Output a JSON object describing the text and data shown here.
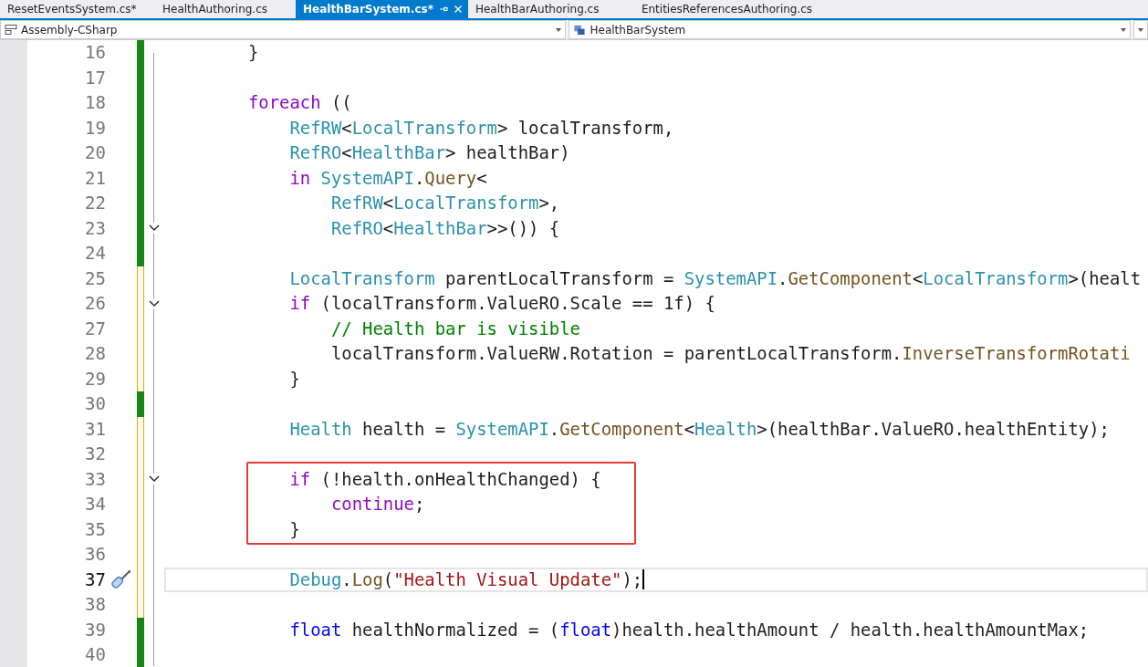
{
  "tabs": [
    {
      "label": "ResetEventsSystem.cs*",
      "selected": false
    },
    {
      "label": "HealthAuthoring.cs",
      "selected": false
    },
    {
      "label": "HealthBarSystem.cs*",
      "selected": true
    },
    {
      "label": "HealthBarAuthoring.cs",
      "selected": false
    },
    {
      "label": "EntitiesReferencesAuthoring.cs",
      "selected": false
    }
  ],
  "navigation_bar": {
    "project": "Assembly-CSharp",
    "type": "HealthBarSystem"
  },
  "editor": {
    "lines": [
      {
        "number": "16",
        "saved": true,
        "fold": false,
        "boxed": false,
        "current": false,
        "tokens": [
          {
            "kind": "plain",
            "text": "        }"
          }
        ]
      },
      {
        "number": "17",
        "saved": true,
        "fold": false,
        "boxed": false,
        "current": false
      },
      {
        "number": "18",
        "saved": true,
        "fold": false,
        "boxed": false,
        "current": false,
        "tokens": [
          {
            "kind": "control",
            "text": "        foreach"
          },
          {
            "kind": "plain",
            "text": " (("
          }
        ]
      },
      {
        "number": "19",
        "saved": true,
        "fold": false,
        "boxed": false,
        "current": false,
        "tokens": [
          {
            "kind": "type",
            "text": "            RefRW"
          },
          {
            "kind": "plain",
            "text": "<"
          },
          {
            "kind": "type",
            "text": "LocalTransform"
          },
          {
            "kind": "plain",
            "text": "> localTransform,"
          }
        ]
      },
      {
        "number": "20",
        "saved": true,
        "fold": false,
        "boxed": false,
        "current": false,
        "tokens": [
          {
            "kind": "type",
            "text": "            RefRO"
          },
          {
            "kind": "plain",
            "text": "<"
          },
          {
            "kind": "type",
            "text": "HealthBar"
          },
          {
            "kind": "plain",
            "text": "> healthBar)"
          }
        ]
      },
      {
        "number": "21",
        "saved": true,
        "fold": false,
        "boxed": false,
        "current": false,
        "tokens": [
          {
            "kind": "control",
            "text": "            in"
          },
          {
            "kind": "type",
            "text": " SystemAPI"
          },
          {
            "kind": "plain",
            "text": "."
          },
          {
            "kind": "method",
            "text": "Query"
          },
          {
            "kind": "plain",
            "text": "<"
          }
        ]
      },
      {
        "number": "22",
        "saved": true,
        "fold": false,
        "boxed": false,
        "current": false,
        "tokens": [
          {
            "kind": "type",
            "text": "                RefRW"
          },
          {
            "kind": "plain",
            "text": "<"
          },
          {
            "kind": "type",
            "text": "LocalTransform"
          },
          {
            "kind": "plain",
            "text": ">,"
          }
        ]
      },
      {
        "number": "23",
        "saved": true,
        "fold": true,
        "boxed": false,
        "current": false,
        "tokens": [
          {
            "kind": "type",
            "text": "                RefRO"
          },
          {
            "kind": "plain",
            "text": "<"
          },
          {
            "kind": "type",
            "text": "HealthBar"
          },
          {
            "kind": "plain",
            "text": ">>()) {"
          }
        ]
      },
      {
        "number": "24",
        "saved": true,
        "fold": false,
        "boxed": false,
        "current": false
      },
      {
        "number": "25",
        "saved": false,
        "fold": false,
        "boxed": false,
        "current": false,
        "tokens": [
          {
            "kind": "type",
            "text": "            LocalTransform"
          },
          {
            "kind": "plain",
            "text": " parentLocalTransform = "
          },
          {
            "kind": "type",
            "text": "SystemAPI"
          },
          {
            "kind": "plain",
            "text": "."
          },
          {
            "kind": "method",
            "text": "GetComponent"
          },
          {
            "kind": "plain",
            "text": "<"
          },
          {
            "kind": "type",
            "text": "LocalTransform"
          },
          {
            "kind": "plain",
            "text": ">(healt"
          }
        ]
      },
      {
        "number": "26",
        "saved": false,
        "fold": true,
        "boxed": false,
        "current": false,
        "tokens": [
          {
            "kind": "control",
            "text": "            if"
          },
          {
            "kind": "plain",
            "text": " (localTransform.ValueRO.Scale == 1f) {"
          }
        ]
      },
      {
        "number": "27",
        "saved": false,
        "fold": false,
        "boxed": false,
        "current": false,
        "tokens": [
          {
            "kind": "comment",
            "text": "                // Health bar is visible"
          }
        ]
      },
      {
        "number": "28",
        "saved": false,
        "fold": false,
        "boxed": false,
        "current": false,
        "tokens": [
          {
            "kind": "plain",
            "text": "                localTransform.ValueRW.Rotation = parentLocalTransform."
          },
          {
            "kind": "method",
            "text": "InverseTransformRotati"
          }
        ]
      },
      {
        "number": "29",
        "saved": false,
        "fold": false,
        "boxed": false,
        "current": false,
        "tokens": [
          {
            "kind": "plain",
            "text": "            }"
          }
        ]
      },
      {
        "number": "30",
        "saved": true,
        "fold": false,
        "boxed": false,
        "current": false
      },
      {
        "number": "31",
        "saved": false,
        "fold": false,
        "boxed": false,
        "current": false,
        "tokens": [
          {
            "kind": "type",
            "text": "            Health"
          },
          {
            "kind": "plain",
            "text": " health = "
          },
          {
            "kind": "type",
            "text": "SystemAPI"
          },
          {
            "kind": "plain",
            "text": "."
          },
          {
            "kind": "method",
            "text": "GetComponent"
          },
          {
            "kind": "plain",
            "text": "<"
          },
          {
            "kind": "type",
            "text": "Health"
          },
          {
            "kind": "plain",
            "text": ">(healthBar.ValueRO.healthEntity);"
          }
        ]
      },
      {
        "number": "32",
        "saved": false,
        "fold": false,
        "boxed": false,
        "current": false
      },
      {
        "number": "33",
        "saved": false,
        "fold": true,
        "boxed": true,
        "current": false,
        "tokens": [
          {
            "kind": "control",
            "text": "            if"
          },
          {
            "kind": "plain",
            "text": " (!health.onHealthChanged) {"
          }
        ]
      },
      {
        "number": "34",
        "saved": false,
        "fold": false,
        "boxed": true,
        "current": false,
        "tokens": [
          {
            "kind": "control",
            "text": "                continue"
          },
          {
            "kind": "plain",
            "text": ";"
          }
        ]
      },
      {
        "number": "35",
        "saved": false,
        "fold": false,
        "boxed": true,
        "current": false,
        "tokens": [
          {
            "kind": "plain",
            "text": "            }"
          }
        ]
      },
      {
        "number": "36",
        "saved": false,
        "fold": false,
        "boxed": false,
        "current": false
      },
      {
        "number": "37",
        "saved": false,
        "fold": false,
        "boxed": false,
        "current": true,
        "tokens": [
          {
            "kind": "type",
            "text": "            Debug"
          },
          {
            "kind": "plain",
            "text": "."
          },
          {
            "kind": "method",
            "text": "Log"
          },
          {
            "kind": "plain",
            "text": "("
          },
          {
            "kind": "string",
            "text": "\"Health Visual Update\""
          },
          {
            "kind": "plain",
            "text": ");"
          }
        ]
      },
      {
        "number": "38",
        "saved": false,
        "fold": false,
        "boxed": false,
        "current": false
      },
      {
        "number": "39",
        "saved": true,
        "fold": false,
        "boxed": false,
        "current": false,
        "tokens": [
          {
            "kind": "keyword",
            "text": "            float"
          },
          {
            "kind": "plain",
            "text": " healthNormalized = ("
          },
          {
            "kind": "keyword",
            "text": "float"
          },
          {
            "kind": "plain",
            "text": ")health.healthAmount / health.healthAmountMax;"
          }
        ]
      },
      {
        "number": "40",
        "saved": true,
        "fold": false,
        "boxed": false,
        "current": false
      }
    ]
  }
}
